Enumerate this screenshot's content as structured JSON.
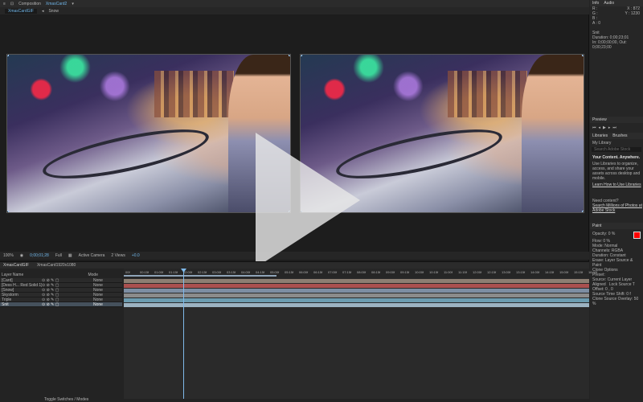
{
  "comp_panel": {
    "title": "Composition",
    "comp_name": "XmasCard2",
    "tab": "XmasCardGIF",
    "snow_label": "Snow",
    "footer": {
      "zoom": "100%",
      "timecode": "0;00;01;28",
      "resolution": "Full",
      "camera": "Active Camera",
      "views": "2 Views",
      "exposure": "+0.0"
    }
  },
  "info_panel": {
    "tab_info": "Info",
    "tab_audio": "Audio",
    "channels": [
      "R :",
      "G :",
      "B :",
      "A : 0"
    ],
    "x": "X : 872",
    "y": "Y : 1230",
    "layer_name": "Snit",
    "duration": "Duration: 0;00;23;01",
    "in_out": "In: 0;00;00;00, Out: 0;00;23;00"
  },
  "preview_panel": {
    "title": "Preview"
  },
  "libraries_panel": {
    "tab_libraries": "Libraries",
    "tab_brushes": "Brushes",
    "library_select": "My Library",
    "search_placeholder": "Search Adobe Stock",
    "heading": "Your Content. Anywhere.",
    "body": "Use Libraries to organize, access, and share your assets across desktop and mobile.",
    "learn_link": "Learn How to Use Libraries",
    "need_content": "Need content?",
    "stock_link": "Search Millions of Photos at Adobe Stock"
  },
  "paint_panel": {
    "title": "Paint",
    "opacity": "Opacity: 0 %",
    "flow": "Flow: 0 %",
    "mode": "Mode: Normal",
    "channels": "Channels: RGBA",
    "duration": "Duration: Constant",
    "erase": "Erase: Layer Source & Paint",
    "clone_options": "Clone Options",
    "preset": "Preset:",
    "source": "Source: Current Layer",
    "aligned": "Aligned",
    "lock_source": "Lock Source T",
    "offset": "Offset: 0 , 0",
    "source_time_shift": "Source Time Shift: 0 f",
    "clone_overlay": "Clone Source Overlay: 50 %",
    "color": "#ff0000"
  },
  "timeline": {
    "tab_active": "XmasCardGIF",
    "tab_other": "XmasCard1920x1080",
    "source_name_header": "Layer Name",
    "mode_header": "Mode",
    "ruler_ticks": [
      "00f",
      "00:15f",
      "01:00f",
      "01:15f",
      "02:00f",
      "02:15f",
      "03:00f",
      "03:15f",
      "04:00f",
      "04:15f",
      "05:00f",
      "05:15f",
      "06:00f",
      "06:15f",
      "07:00f",
      "07:15f",
      "08:00f",
      "08:15f",
      "09:00f",
      "09:15f",
      "10:00f",
      "10:15f",
      "11:00f",
      "11:15f",
      "12:00f",
      "12:15f",
      "13:00f",
      "13:15f",
      "14:00f",
      "14:15f",
      "15:00f",
      "15:15f",
      "16:00f"
    ],
    "layers": [
      {
        "name": "[Card]",
        "mode": "None",
        "color": "#8c7f73"
      },
      {
        "name": "[Dess H... Red Solid 1]",
        "mode": "None",
        "color": "#a9504f"
      },
      {
        "name": "[Snow]",
        "mode": "None",
        "color": "#7d8ea3"
      },
      {
        "name": "Skystorm",
        "mode": "None",
        "color": "#8b8b8b"
      },
      {
        "name": "Triple",
        "mode": "None",
        "color": "#6c9cb0"
      },
      {
        "name": "Snit",
        "mode": "None",
        "color": "#9cb3c2"
      }
    ],
    "bottom_label": "Toggle Switches / Modes"
  }
}
